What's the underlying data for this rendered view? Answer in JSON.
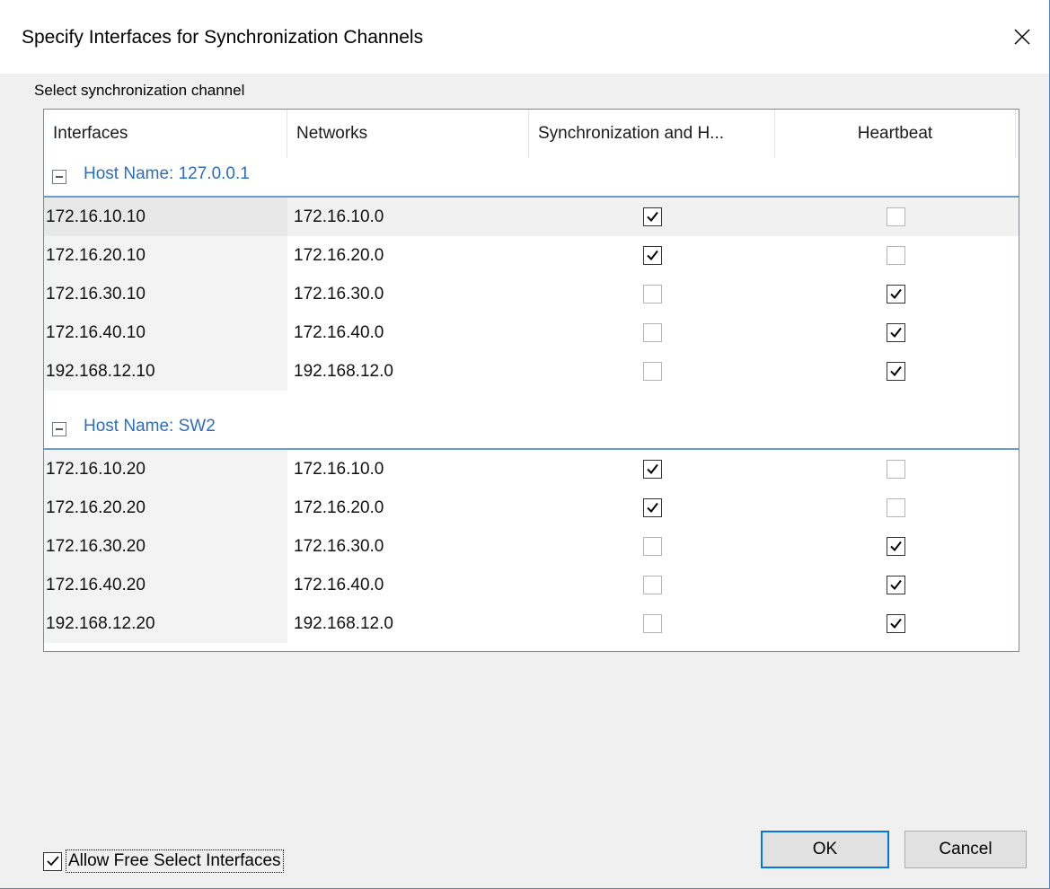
{
  "window": {
    "title": "Specify Interfaces for Synchronization Channels",
    "close_icon": "close-icon"
  },
  "section_label": "Select synchronization channel",
  "columns": [
    "Interfaces",
    "Networks",
    "Synchronization and H...",
    "Heartbeat"
  ],
  "groups": [
    {
      "title": "Host Name: 127.0.0.1",
      "rows": [
        {
          "interface": "172.16.10.10",
          "network": "172.16.10.0",
          "sync": true,
          "heartbeat": false,
          "selected": true
        },
        {
          "interface": "172.16.20.10",
          "network": "172.16.20.0",
          "sync": true,
          "heartbeat": false,
          "selected": false
        },
        {
          "interface": "172.16.30.10",
          "network": "172.16.30.0",
          "sync": false,
          "heartbeat": true,
          "selected": false
        },
        {
          "interface": "172.16.40.10",
          "network": "172.16.40.0",
          "sync": false,
          "heartbeat": true,
          "selected": false
        },
        {
          "interface": "192.168.12.10",
          "network": "192.168.12.0",
          "sync": false,
          "heartbeat": true,
          "selected": false
        }
      ]
    },
    {
      "title": "Host Name: SW2",
      "rows": [
        {
          "interface": "172.16.10.20",
          "network": "172.16.10.0",
          "sync": true,
          "heartbeat": false,
          "selected": false
        },
        {
          "interface": "172.16.20.20",
          "network": "172.16.20.0",
          "sync": true,
          "heartbeat": false,
          "selected": false
        },
        {
          "interface": "172.16.30.20",
          "network": "172.16.30.0",
          "sync": false,
          "heartbeat": true,
          "selected": false
        },
        {
          "interface": "172.16.40.20",
          "network": "172.16.40.0",
          "sync": false,
          "heartbeat": true,
          "selected": false
        },
        {
          "interface": "192.168.12.20",
          "network": "192.168.12.0",
          "sync": false,
          "heartbeat": true,
          "selected": false
        }
      ]
    }
  ],
  "footer": {
    "allow_free_select_label": "Allow Free Select Interfaces",
    "allow_free_select_checked": true,
    "ok_label": "OK",
    "cancel_label": "Cancel"
  },
  "colors": {
    "group_title": "#2b6ebe",
    "group_line": "#6f9ad0",
    "ok_border": "#0078d7"
  }
}
